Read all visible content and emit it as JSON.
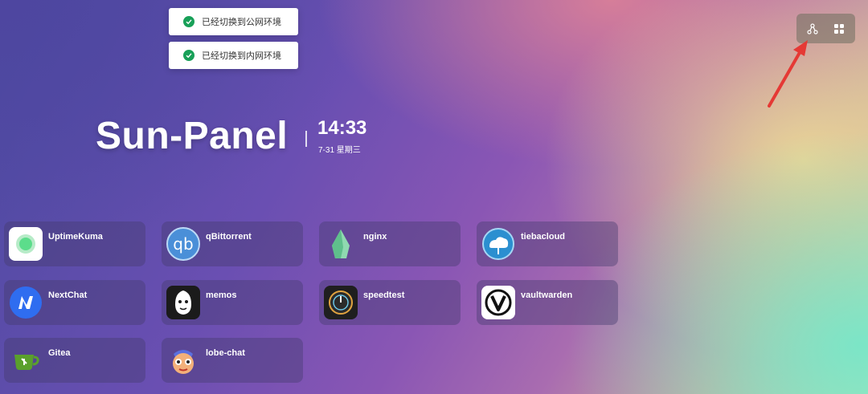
{
  "toasts": [
    {
      "text": "已经切换到公网环境"
    },
    {
      "text": "已经切换到内网环境"
    }
  ],
  "toolbar": {
    "items": [
      {
        "icon": "network-icon"
      },
      {
        "icon": "grid-icon"
      }
    ]
  },
  "header": {
    "logo": "Sun-Panel",
    "time": "14:33",
    "date": "7-31 星期三"
  },
  "apps": [
    {
      "name": "UptimeKuma",
      "icon": "uptimekuma-icon"
    },
    {
      "name": "qBittorrent",
      "icon": "qbittorrent-icon"
    },
    {
      "name": "nginx",
      "icon": "nginx-icon"
    },
    {
      "name": "tiebacloud",
      "icon": "tiebacloud-icon"
    },
    {
      "name": "NextChat",
      "icon": "nextchat-icon"
    },
    {
      "name": "memos",
      "icon": "memos-icon"
    },
    {
      "name": "speedtest",
      "icon": "speedtest-icon"
    },
    {
      "name": "vaultwarden",
      "icon": "vaultwarden-icon"
    },
    {
      "name": "Gitea",
      "icon": "gitea-icon"
    },
    {
      "name": "lobe-chat",
      "icon": "lobe-chat-icon"
    }
  ],
  "colors": {
    "toast_success": "#18a058",
    "annotation_arrow": "#e53935"
  }
}
